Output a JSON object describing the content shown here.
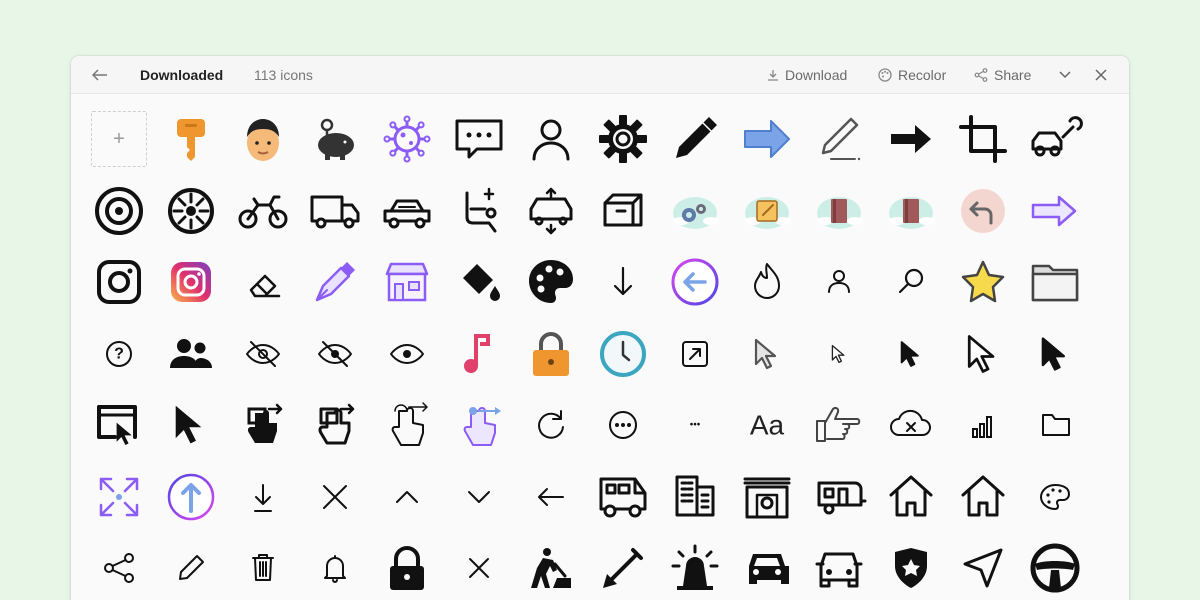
{
  "header": {
    "title": "Downloaded",
    "count": "113 icons",
    "download_label": "Download",
    "recolor_label": "Recolor",
    "share_label": "Share"
  },
  "add_button": {
    "symbol": "+"
  },
  "colors": {
    "background": "#e8f6e8",
    "accent_purple": "#8b5cf6",
    "accent_blue": "#7aa3e8",
    "accent_orange": "#f0962f",
    "accent_pink": "#e0416b",
    "clock_teal": "#3aa6c0"
  },
  "text_icons": {
    "aa": "Aa",
    "question": "?",
    "dots": "•••"
  },
  "icons": [
    [
      "key-icon",
      "face-icon",
      "piggy-bank-icon",
      "virus-icon",
      "chat-dots-icon",
      "user-icon",
      "gear-icon",
      "pen-icon",
      "arrow-right-blue-icon",
      "pen-outline-icon",
      "arrow-right-bold-icon",
      "crop-icon",
      "car-wrench-icon"
    ],
    [
      "wheel-icon",
      "wheel-2-icon",
      "motorbike-icon",
      "truck-icon",
      "car-icon",
      "car-seat-icon",
      "car-lift-icon",
      "box-icon",
      "gears-cloud-icon",
      "note-cloud-icon",
      "book-cloud-icon",
      "book-cloud-2-icon",
      "return-arrow-icon",
      "arrow-right-outline-icon"
    ],
    [
      "instagram-icon",
      "instagram-color-icon",
      "eraser-icon",
      "fountain-pen-icon",
      "store-icon",
      "paint-bucket-icon",
      "palette-icon",
      "arrow-down-icon",
      "arrow-left-circle-icon",
      "flame-icon",
      "user-small-icon",
      "search-icon",
      "star-icon",
      "folder-icon"
    ],
    [
      "question-icon",
      "users-icon",
      "eye-off-icon",
      "eye-off-2-icon",
      "eye-icon",
      "music-note-icon",
      "lock-orange-icon",
      "clock-icon",
      "external-link-icon",
      "cursor-outline-icon",
      "cursor-small-icon",
      "cursor-solid-icon",
      "cursor-outline-bold-icon",
      "cursor-solid-2-icon"
    ],
    [
      "window-cursor-icon",
      "cursor-large-icon",
      "tap-solid-icon",
      "tap-outline-icon",
      "tap-swipe-icon",
      "tap-color-icon",
      "refresh-icon",
      "more-circle-icon",
      "more-horizontal-icon",
      "font-icon",
      "pointing-hand-icon",
      "cloud-x-icon",
      "signal-icon",
      "folder-outline-icon"
    ],
    [
      "expand-arrows-icon",
      "arrow-up-circle-icon",
      "download-icon",
      "close-x-icon",
      "chevron-up-icon",
      "chevron-down-icon",
      "arrow-left-icon",
      "rv-icon",
      "building-icon",
      "garage-icon",
      "trailer-icon",
      "home-icon",
      "home-2-icon",
      "palette-small-icon"
    ],
    [
      "share-icon",
      "pencil-icon",
      "trash-icon",
      "bell-icon",
      "lock-icon",
      "close-small-icon",
      "construction-icon",
      "shovel-icon",
      "siren-icon",
      "car-front-icon",
      "car-front-2-icon",
      "police-badge-icon",
      "navigation-icon",
      "steering-wheel-icon"
    ]
  ]
}
